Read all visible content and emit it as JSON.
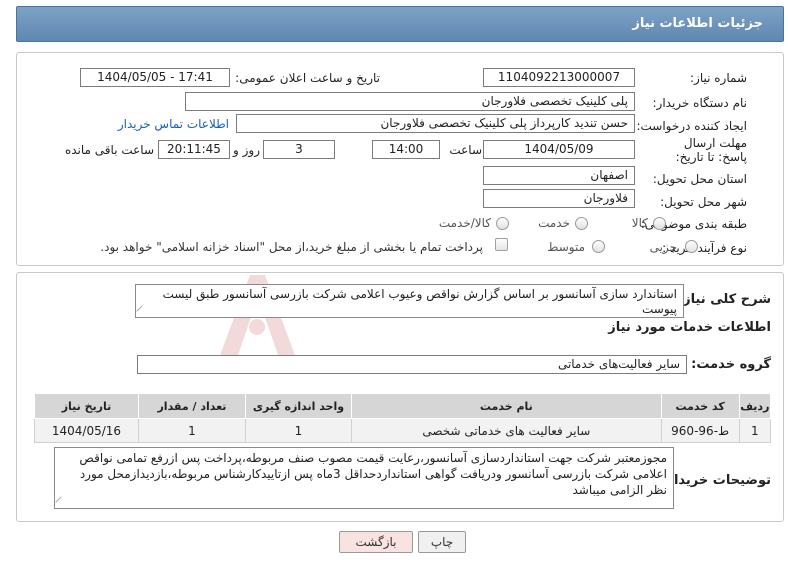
{
  "page": {
    "header_title": "جزئیات اطلاعات نیاز"
  },
  "form": {
    "need_number_label": "شماره نیاز:",
    "need_number": "1104092213000007",
    "announce_label": "تاریخ و ساعت اعلان عمومی:",
    "announce_value": "1404/05/05 - 17:41",
    "buyer_org_label": "نام دستگاه خریدار:",
    "buyer_org": "پلی کلینیک تخصصی فلاورجان",
    "creator_label": "ایجاد کننده درخواست:",
    "creator": "حسن تندید کارپرداز پلی کلینیک تخصصی فلاورجان",
    "contact_link": "اطلاعات تماس خریدار",
    "deadline_label": "مهلت ارسال پاسخ: تا تاریخ:",
    "deadline_date": "1404/05/09",
    "time_label": "ساعت",
    "deadline_time": "14:00",
    "days_value": "3",
    "days_label": "روز و",
    "remaining_time": "20:11:45",
    "remaining_label": "ساعت باقی مانده",
    "province_label": "استان محل تحویل:",
    "province": "اصفهان",
    "city_label": "شهر محل تحویل:",
    "city": "فلاورجان",
    "category_label": "طبقه بندی موضوعی:",
    "category_options": [
      "کالا",
      "خدمت",
      "کالا/خدمت"
    ],
    "purchase_type_label": "نوع فرآیند خرید :",
    "purchase_options": [
      "جزیی",
      "متوسط"
    ],
    "payment_note": "پرداخت تمام یا بخشی از مبلغ خرید،از محل \"اسناد خزانه اسلامی\" خواهد بود."
  },
  "details": {
    "summary_label": "شرح کلی نیاز:",
    "summary": "استاندارد سازی آسانسور بر اساس گزارش نواقص وعیوب اعلامی شرکت بازرسی آسانسور طبق لیست پیوست",
    "services_heading": "اطلاعات خدمات مورد نیاز",
    "service_group_label": "گروه خدمت:",
    "service_group": "سایر فعالیت‌های خدماتی",
    "table_headers": [
      "ردیف",
      "کد خدمت",
      "نام خدمت",
      "واحد اندازه گیری",
      "تعداد / مقدار",
      "تاریخ نیاز"
    ],
    "table_rows": [
      [
        "1",
        "ط-96-960",
        "سایر فعالیت های خدماتی شخصی",
        "1",
        "1",
        "1404/05/16"
      ]
    ],
    "buyer_notes_label": "توضیحات خریدار:",
    "buyer_notes": "مجوزمعتبر شرکت جهت استانداردسازی آسانسور،رعایت قیمت مصوب صنف مربوطه،پرداخت پس ازرفع تمامی نواقص اعلامی شرکت بازرسی آسانسور ودریافت گواهی استانداردحداقل 3ماه پس ازتاییدکارشناس مربوطه،بازدیدازمحل مورد نظر الزامی میباشد"
  },
  "buttons": {
    "print": "چاپ",
    "back": "بازگشت"
  },
  "colors": {
    "header_bg": "#6a90b8",
    "link": "#1a5fb4",
    "back_button_bg": "#f8e2e2"
  }
}
